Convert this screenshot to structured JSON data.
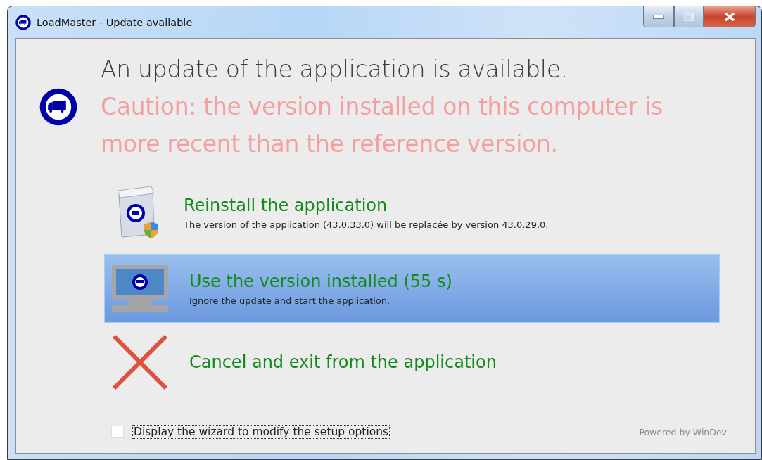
{
  "window": {
    "title": "LoadMaster - Update available"
  },
  "heading": "An update of the application is available.",
  "caution": "Caution: the version installed on this computer is more recent than the reference version.",
  "options": [
    {
      "kind": "reinstall",
      "title": "Reinstall the application",
      "description": "The version of the application (43.0.33.0) will be replacée by version 43.0.29.0.",
      "selected": false
    },
    {
      "kind": "use",
      "title": "Use the version installed (55 s)",
      "description": "Ignore the update and start the application.",
      "selected": true
    },
    {
      "kind": "cancel",
      "title": "Cancel and exit from the application",
      "selected": false
    }
  ],
  "wizard_checkbox": {
    "label": "Display the wizard to modify the setup options",
    "checked": false
  },
  "footer": "Powered by WinDev"
}
